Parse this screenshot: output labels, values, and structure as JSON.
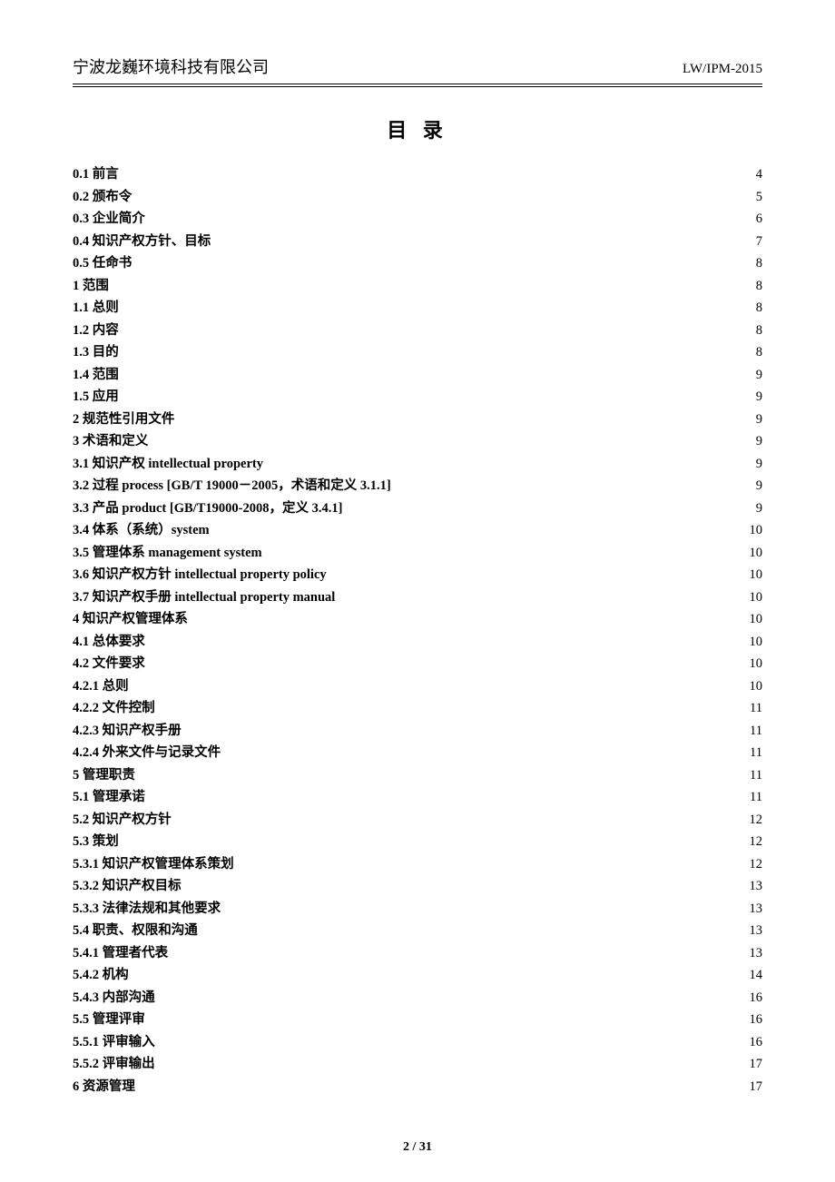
{
  "header": {
    "left": "宁波龙巍环境科技有限公司",
    "right": "LW/IPM-2015"
  },
  "toc_title": "目 录",
  "toc": [
    {
      "label": "0.1  前言",
      "page": "4"
    },
    {
      "label": "0.2 颁布令",
      "page": "5"
    },
    {
      "label": "0.3 企业简介",
      "page": "6"
    },
    {
      "label": "0.4 知识产权方针、目标",
      "page": "7"
    },
    {
      "label": "0.5  任命书",
      "page": "8"
    },
    {
      "label": "1  范围",
      "page": "8"
    },
    {
      "label": "1.1  总则",
      "page": "8"
    },
    {
      "label": "1.2  内容",
      "page": "8"
    },
    {
      "label": "1.3  目的",
      "page": "8"
    },
    {
      "label": "1.4  范围",
      "page": "9"
    },
    {
      "label": "1.5  应用",
      "page": "9"
    },
    {
      "label": "2  规范性引用文件",
      "page": "9"
    },
    {
      "label": "3  术语和定义",
      "page": "9"
    },
    {
      "label": "3.1 知识产权  intellectual property",
      "page": "9"
    },
    {
      "label": "3.2 过程 process      [GB/T 19000－2005，术语和定义 3.1.1]",
      "page": "9"
    },
    {
      "label": "3.3 产品 product     [GB/T19000-2008，定义 3.4.1]",
      "page": "9"
    },
    {
      "label": "3.4 体系（系统）system",
      "page": "10"
    },
    {
      "label": "3.5 管理体系   management system",
      "page": "10"
    },
    {
      "label": "3.6 知识产权方针 intellectual property policy",
      "page": "10"
    },
    {
      "label": "3.7 知识产权手册 intellectual property manual",
      "page": "10"
    },
    {
      "label": "4  知识产权管理体系",
      "page": "10"
    },
    {
      "label": "4.1  总体要求",
      "page": "10"
    },
    {
      "label": "4.2  文件要求",
      "page": "10"
    },
    {
      "label": "4.2.1 总则",
      "page": "10"
    },
    {
      "label": "4.2.2 文件控制",
      "page": "11"
    },
    {
      "label": "4.2.3 知识产权手册",
      "page": "11"
    },
    {
      "label": "4.2.4 外来文件与记录文件",
      "page": "11"
    },
    {
      "label": "5 管理职责",
      "page": "11"
    },
    {
      "label": "5.1 管理承诺",
      "page": "11"
    },
    {
      "label": "5.2 知识产权方针",
      "page": "12"
    },
    {
      "label": "5.3 策划",
      "page": "12"
    },
    {
      "label": "5.3.1 知识产权管理体系策划",
      "page": "12"
    },
    {
      "label": "5.3.2 知识产权目标",
      "page": "13"
    },
    {
      "label": "5.3.3 法律法规和其他要求",
      "page": "13"
    },
    {
      "label": "5.4 职责、权限和沟通",
      "page": "13"
    },
    {
      "label": "5.4.1 管理者代表",
      "page": "13"
    },
    {
      "label": "5.4.2 机构",
      "page": "14"
    },
    {
      "label": "5.4.3 内部沟通",
      "page": "16"
    },
    {
      "label": "5.5 管理评审",
      "page": "16"
    },
    {
      "label": "5.5.1 评审输入",
      "page": "16"
    },
    {
      "label": "5.5.2 评审输出",
      "page": "17"
    },
    {
      "label": "6 资源管理",
      "page": "17"
    }
  ],
  "footer": "2 / 31"
}
